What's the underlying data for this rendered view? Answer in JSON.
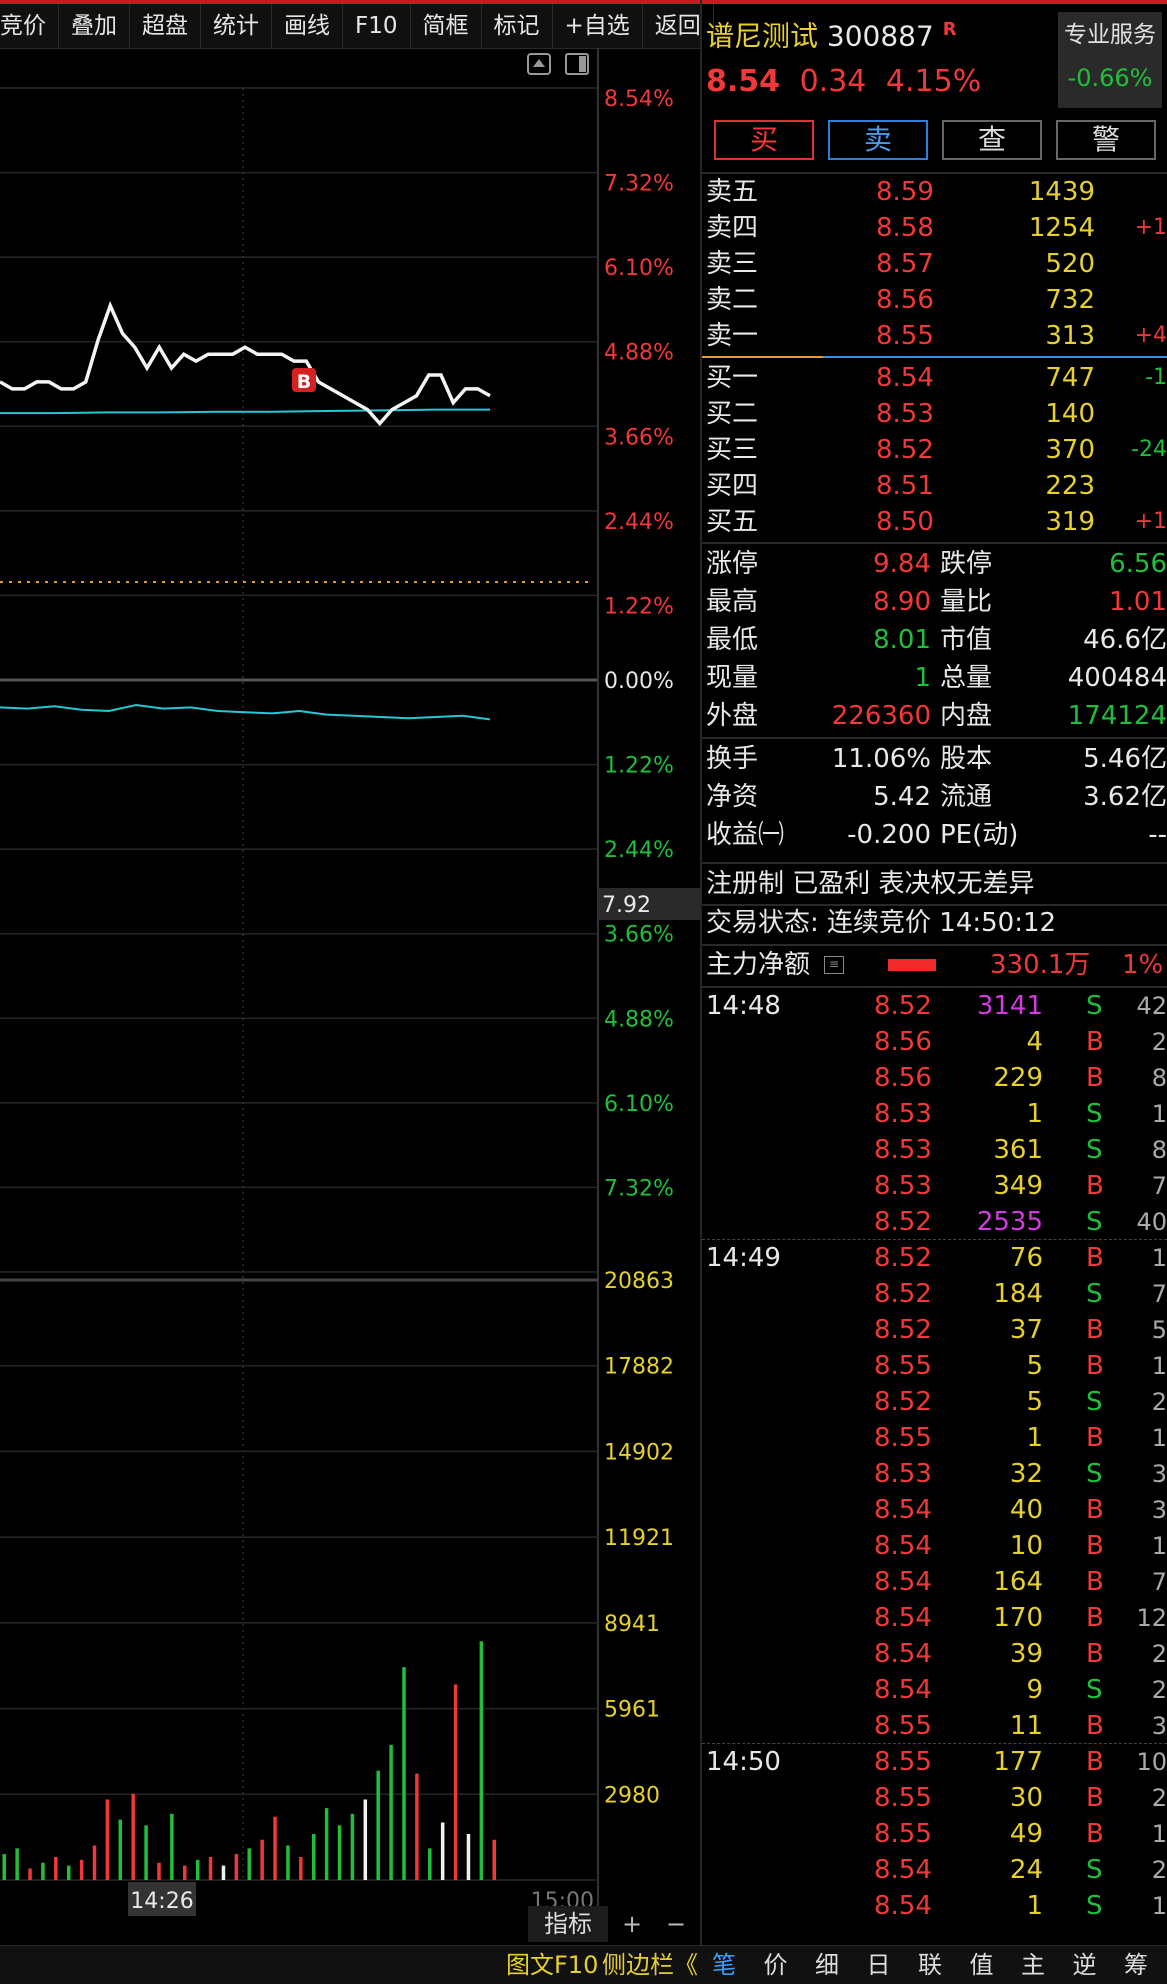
{
  "toolbar": [
    "竞价",
    "叠加",
    "超盘",
    "统计",
    "画线",
    "F10",
    "简框",
    "标记",
    "+自选",
    "返回"
  ],
  "chart": {
    "price_labels_up": [
      "8.54%",
      "7.32%",
      "6.10%",
      "4.88%",
      "3.66%",
      "2.44%",
      "1.22%"
    ],
    "zero_label": "0.00%",
    "price_labels_down": [
      "1.22%",
      "2.44%",
      "3.66%",
      "4.88%",
      "6.10%",
      "7.32%"
    ],
    "cursor_price": "7.92",
    "volume_labels": [
      "20863",
      "17882",
      "14902",
      "11921",
      "8941",
      "5961",
      "2980"
    ],
    "time_cursor": "14:26",
    "time_end": "15:00",
    "marker_b": "B",
    "chart_data": {
      "type": "line",
      "price_pct_series": [
        4.3,
        4.2,
        4.2,
        4.3,
        4.3,
        4.2,
        4.2,
        4.3,
        4.9,
        5.4,
        5.0,
        4.8,
        4.5,
        4.8,
        4.5,
        4.7,
        4.6,
        4.7,
        4.7,
        4.7,
        4.8,
        4.7,
        4.7,
        4.7,
        4.6,
        4.6,
        4.3,
        4.2,
        4.1,
        4.0,
        3.9,
        3.7,
        3.9,
        4.0,
        4.1,
        4.4,
        4.4,
        4.0,
        4.2,
        4.2,
        4.1
      ],
      "avg_pct_series": [
        3.85,
        3.85,
        3.86,
        3.86,
        3.87,
        3.87,
        3.88,
        3.89,
        3.9,
        3.9
      ],
      "breadth_pct_series": [
        -0.3,
        -0.31,
        -0.29,
        -0.32,
        -0.33,
        -0.28,
        -0.31,
        -0.3,
        -0.33,
        -0.34,
        -0.35,
        -0.33,
        -0.36,
        -0.37,
        -0.38,
        -0.39,
        -0.38,
        -0.37,
        -0.4
      ],
      "volumes": [
        900,
        1100,
        400,
        600,
        800,
        500,
        700,
        1200,
        2800,
        2100,
        3000,
        1900,
        600,
        2300,
        500,
        700,
        800,
        500,
        900,
        1100,
        1400,
        2200,
        1200,
        800,
        1600,
        2500,
        1900,
        2300,
        2800,
        3800,
        4700,
        7400,
        3700,
        1100,
        2000,
        6800,
        1600,
        8300,
        1400
      ],
      "volume_colors": [
        "g",
        "g",
        "r",
        "g",
        "r",
        "g",
        "r",
        "r",
        "r",
        "g",
        "r",
        "g",
        "r",
        "g",
        "r",
        "g",
        "r",
        "w",
        "r",
        "g",
        "r",
        "r",
        "g",
        "r",
        "g",
        "g",
        "g",
        "g",
        "w",
        "g",
        "g",
        "g",
        "r",
        "g",
        "w",
        "r",
        "w",
        "g",
        "r"
      ],
      "ylim_pct": [
        -8.54,
        8.54
      ],
      "volume_max": 20863
    }
  },
  "side": {
    "name": "谱尼测试",
    "code": "300887",
    "reg_flag": "R",
    "service": "专业服务",
    "service_pct": "-0.66%",
    "price": "8.54",
    "change": "0.34",
    "change_pct": "4.15%",
    "buttons": [
      "买",
      "卖",
      "查",
      "警"
    ],
    "asks": [
      {
        "label": "卖五",
        "price": "8.59",
        "vol": "1439",
        "chg": ""
      },
      {
        "label": "卖四",
        "price": "8.58",
        "vol": "1254",
        "chg": "+1"
      },
      {
        "label": "卖三",
        "price": "8.57",
        "vol": "520",
        "chg": ""
      },
      {
        "label": "卖二",
        "price": "8.56",
        "vol": "732",
        "chg": ""
      },
      {
        "label": "卖一",
        "price": "8.55",
        "vol": "313",
        "chg": "+4"
      }
    ],
    "bids": [
      {
        "label": "买一",
        "price": "8.54",
        "vol": "747",
        "chg": "-1"
      },
      {
        "label": "买二",
        "price": "8.53",
        "vol": "140",
        "chg": ""
      },
      {
        "label": "买三",
        "price": "8.52",
        "vol": "370",
        "chg": "-24"
      },
      {
        "label": "买四",
        "price": "8.51",
        "vol": "223",
        "chg": ""
      },
      {
        "label": "买五",
        "price": "8.50",
        "vol": "319",
        "chg": "+1"
      }
    ],
    "stats1": [
      {
        "l1": "涨停",
        "v1": "9.84",
        "c1": "red",
        "l2": "跌停",
        "v2": "6.56",
        "c2": "green"
      },
      {
        "l1": "最高",
        "v1": "8.90",
        "c1": "red",
        "l2": "量比",
        "v2": "1.01",
        "c2": "red"
      },
      {
        "l1": "最低",
        "v1": "8.01",
        "c1": "green",
        "l2": "市值",
        "v2": "46.6亿",
        "c2": "wht"
      },
      {
        "l1": "现量",
        "v1": "1",
        "c1": "green",
        "l2": "总量",
        "v2": "400484",
        "c2": "wht"
      },
      {
        "l1": "外盘",
        "v1": "226360",
        "c1": "red",
        "l2": "内盘",
        "v2": "174124",
        "c2": "green"
      }
    ],
    "stats2": [
      {
        "l1": "换手",
        "v1": "11.06%",
        "c1": "wht",
        "l2": "股本",
        "v2": "5.46亿",
        "c2": "wht"
      },
      {
        "l1": "净资",
        "v1": "5.42",
        "c1": "wht",
        "l2": "流通",
        "v2": "3.62亿",
        "c2": "wht"
      },
      {
        "l1": "收益㈠",
        "v1": "-0.200",
        "c1": "wht",
        "l2": "PE(动)",
        "v2": "--",
        "c2": "wht"
      }
    ],
    "tags": "注册制 已盈利 表决权无差异",
    "status": "交易状态: 连续竞价 14:50:12",
    "main_label": "主力净额",
    "main_value": "330.1万",
    "main_pct": "1%",
    "ticks": [
      {
        "t": "14:48",
        "p": "8.52",
        "v": "3141",
        "vc": "mag",
        "s": "S",
        "n": "42"
      },
      {
        "t": "",
        "p": "8.56",
        "v": "4",
        "vc": "yel",
        "s": "B",
        "n": "2"
      },
      {
        "t": "",
        "p": "8.56",
        "v": "229",
        "vc": "yel",
        "s": "B",
        "n": "8"
      },
      {
        "t": "",
        "p": "8.53",
        "v": "1",
        "vc": "yel",
        "s": "S",
        "n": "1"
      },
      {
        "t": "",
        "p": "8.53",
        "v": "361",
        "vc": "yel",
        "s": "S",
        "n": "8"
      },
      {
        "t": "",
        "p": "8.53",
        "v": "349",
        "vc": "yel",
        "s": "B",
        "n": "7"
      },
      {
        "t": "",
        "p": "8.52",
        "v": "2535",
        "vc": "mag",
        "s": "S",
        "n": "40"
      },
      {
        "t": "14:49",
        "p": "8.52",
        "v": "76",
        "vc": "yel",
        "s": "B",
        "n": "1"
      },
      {
        "t": "",
        "p": "8.52",
        "v": "184",
        "vc": "yel",
        "s": "S",
        "n": "7"
      },
      {
        "t": "",
        "p": "8.52",
        "v": "37",
        "vc": "yel",
        "s": "B",
        "n": "5"
      },
      {
        "t": "",
        "p": "8.55",
        "v": "5",
        "vc": "yel",
        "s": "B",
        "n": "1"
      },
      {
        "t": "",
        "p": "8.52",
        "v": "5",
        "vc": "yel",
        "s": "S",
        "n": "2"
      },
      {
        "t": "",
        "p": "8.55",
        "v": "1",
        "vc": "yel",
        "s": "B",
        "n": "1"
      },
      {
        "t": "",
        "p": "8.53",
        "v": "32",
        "vc": "yel",
        "s": "S",
        "n": "3"
      },
      {
        "t": "",
        "p": "8.54",
        "v": "40",
        "vc": "yel",
        "s": "B",
        "n": "3"
      },
      {
        "t": "",
        "p": "8.54",
        "v": "10",
        "vc": "yel",
        "s": "B",
        "n": "1"
      },
      {
        "t": "",
        "p": "8.54",
        "v": "164",
        "vc": "yel",
        "s": "B",
        "n": "7"
      },
      {
        "t": "",
        "p": "8.54",
        "v": "170",
        "vc": "yel",
        "s": "B",
        "n": "12"
      },
      {
        "t": "",
        "p": "8.54",
        "v": "39",
        "vc": "yel",
        "s": "B",
        "n": "2"
      },
      {
        "t": "",
        "p": "8.54",
        "v": "9",
        "vc": "yel",
        "s": "S",
        "n": "2"
      },
      {
        "t": "",
        "p": "8.55",
        "v": "11",
        "vc": "yel",
        "s": "B",
        "n": "3"
      },
      {
        "t": "14:50",
        "p": "8.55",
        "v": "177",
        "vc": "yel",
        "s": "B",
        "n": "10"
      },
      {
        "t": "",
        "p": "8.55",
        "v": "30",
        "vc": "yel",
        "s": "B",
        "n": "2"
      },
      {
        "t": "",
        "p": "8.55",
        "v": "49",
        "vc": "yel",
        "s": "B",
        "n": "1"
      },
      {
        "t": "",
        "p": "8.54",
        "v": "24",
        "vc": "yel",
        "s": "S",
        "n": "2"
      },
      {
        "t": "",
        "p": "8.54",
        "v": "1",
        "vc": "yel",
        "s": "S",
        "n": "1"
      }
    ]
  },
  "bottom": {
    "indicator": "指标",
    "plus": "+",
    "minus": "−",
    "f10": "图文F10",
    "sidebar": "侧边栏《",
    "tabs": [
      "笔",
      "价",
      "细",
      "日",
      "联",
      "值",
      "主",
      "逆",
      "筹"
    ]
  },
  "colors": {
    "up": "#f03838",
    "down": "#1fbf3b",
    "neutral": "#e6d02e",
    "avg": "#26c8d8"
  }
}
